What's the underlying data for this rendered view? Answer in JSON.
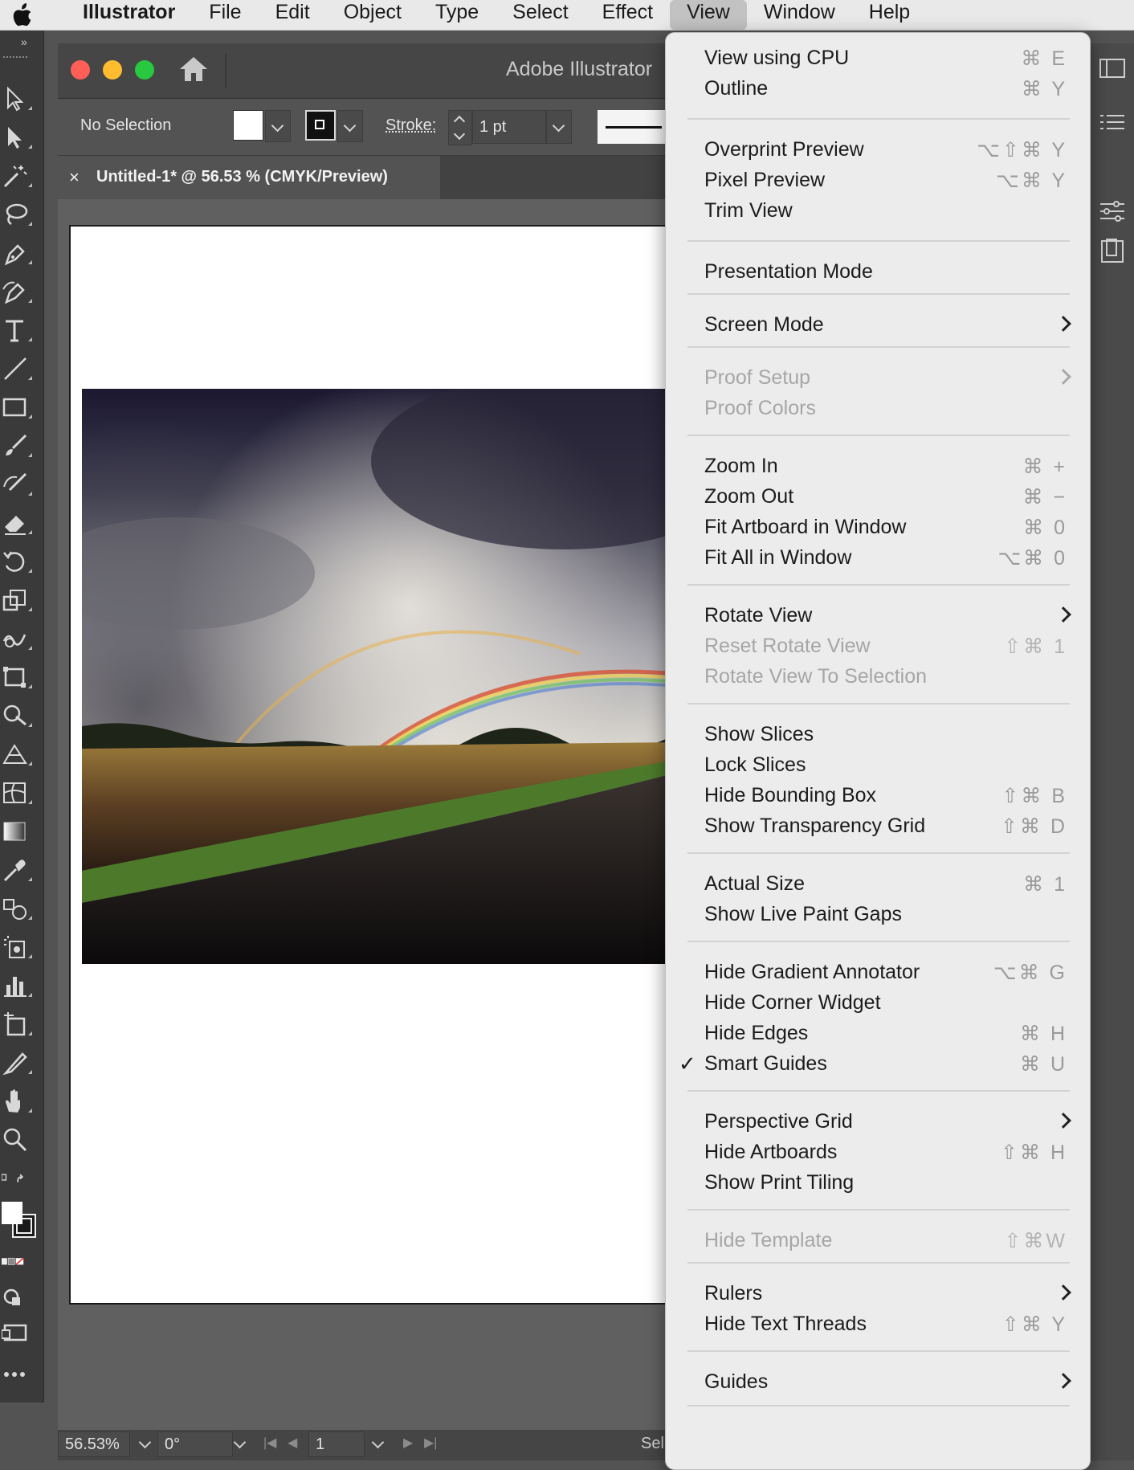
{
  "menubar": {
    "app": "Illustrator",
    "items": [
      "File",
      "Edit",
      "Object",
      "Type",
      "Select",
      "Effect",
      "View",
      "Window",
      "Help"
    ],
    "active": "View"
  },
  "window": {
    "title": "Adobe Illustrator",
    "control_bar": {
      "selection": "No Selection",
      "stroke_label": "Stroke:",
      "stroke_value": "1 pt"
    },
    "document_tab": {
      "close": "×",
      "title": "Untitled-1* @ 56.53 % (CMYK/Preview)"
    },
    "status_bar": {
      "zoom": "56.53%",
      "rotation": "0°",
      "artboard": "1",
      "selection_tool": "Sel"
    }
  },
  "view_menu": {
    "items": [
      {
        "label": "View using CPU",
        "shortcut": "⌘ E",
        "enabled": true
      },
      {
        "label": "Outline",
        "shortcut": "⌘ Y",
        "enabled": true
      },
      {
        "label": "Overprint Preview",
        "shortcut": "⌥⇧⌘ Y",
        "enabled": true
      },
      {
        "label": "Pixel Preview",
        "shortcut": "⌥⌘ Y",
        "enabled": true
      },
      {
        "label": "Trim View",
        "shortcut": "",
        "enabled": true
      },
      {
        "label": "Presentation Mode",
        "shortcut": "",
        "enabled": true
      },
      {
        "label": "Screen Mode",
        "shortcut": "",
        "enabled": true,
        "submenu": true
      },
      {
        "label": "Proof Setup",
        "shortcut": "",
        "enabled": false,
        "submenu": true
      },
      {
        "label": "Proof Colors",
        "shortcut": "",
        "enabled": false
      },
      {
        "label": "Zoom In",
        "shortcut": "⌘ +",
        "enabled": true
      },
      {
        "label": "Zoom Out",
        "shortcut": "⌘ −",
        "enabled": true
      },
      {
        "label": "Fit Artboard in Window",
        "shortcut": "⌘ 0",
        "enabled": true
      },
      {
        "label": "Fit All in Window",
        "shortcut": "⌥⌘ 0",
        "enabled": true
      },
      {
        "label": "Rotate View",
        "shortcut": "",
        "enabled": true,
        "submenu": true
      },
      {
        "label": "Reset Rotate View",
        "shortcut": "⇧⌘ 1",
        "enabled": false
      },
      {
        "label": "Rotate View To Selection",
        "shortcut": "",
        "enabled": false
      },
      {
        "label": "Show Slices",
        "shortcut": "",
        "enabled": true
      },
      {
        "label": "Lock Slices",
        "shortcut": "",
        "enabled": true
      },
      {
        "label": "Hide Bounding Box",
        "shortcut": "⇧⌘ B",
        "enabled": true
      },
      {
        "label": "Show Transparency Grid",
        "shortcut": "⇧⌘ D",
        "enabled": true
      },
      {
        "label": "Actual Size",
        "shortcut": "⌘ 1",
        "enabled": true
      },
      {
        "label": "Show Live Paint Gaps",
        "shortcut": "",
        "enabled": true
      },
      {
        "label": "Hide Gradient Annotator",
        "shortcut": "⌥⌘ G",
        "enabled": true
      },
      {
        "label": "Hide Corner Widget",
        "shortcut": "",
        "enabled": true
      },
      {
        "label": "Hide Edges",
        "shortcut": "⌘ H",
        "enabled": true
      },
      {
        "label": "Smart Guides",
        "shortcut": "⌘ U",
        "enabled": true,
        "checked": true
      },
      {
        "label": "Perspective Grid",
        "shortcut": "",
        "enabled": true,
        "submenu": true
      },
      {
        "label": "Hide Artboards",
        "shortcut": "⇧⌘ H",
        "enabled": true
      },
      {
        "label": "Show Print Tiling",
        "shortcut": "",
        "enabled": true
      },
      {
        "label": "Hide Template",
        "shortcut": "⇧⌘W",
        "enabled": false
      },
      {
        "label": "Rulers",
        "shortcut": "",
        "enabled": true,
        "submenu": true
      },
      {
        "label": "Hide Text Threads",
        "shortcut": "⇧⌘ Y",
        "enabled": true
      },
      {
        "label": "Guides",
        "shortcut": "",
        "enabled": true,
        "submenu": true
      }
    ],
    "check_mark": "✓"
  },
  "colors": {
    "menu_bg": "#ececec",
    "ui_dark": "#535353",
    "traffic_red": "#ff5f57",
    "traffic_yellow": "#febc2e",
    "traffic_green": "#28c840"
  }
}
